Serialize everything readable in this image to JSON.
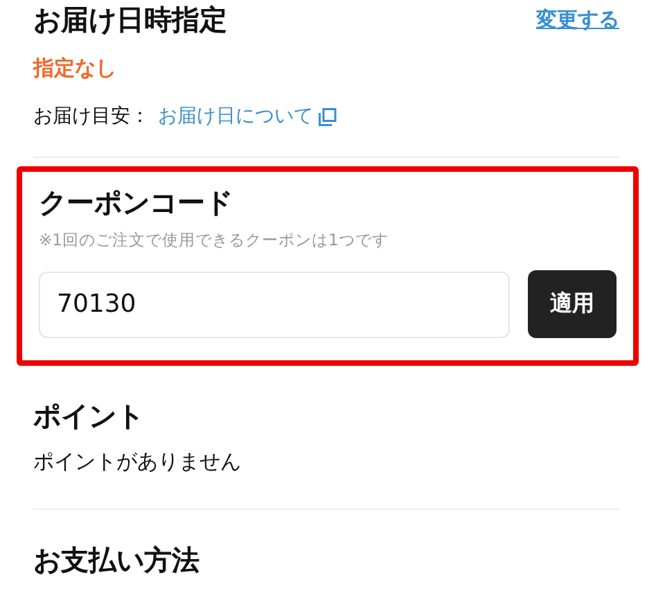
{
  "delivery": {
    "title": "お届け日時指定",
    "change_link": "変更する",
    "selection": "指定なし",
    "estimate_label": "お届け目安：",
    "estimate_link": "お届け日について"
  },
  "coupon": {
    "highlighted": true,
    "title": "クーポンコード",
    "note": "※1回のご注文で使用できるクーポンは1つです",
    "code": "70130",
    "apply_button": "適用"
  },
  "points": {
    "title": "ポイント",
    "message": "ポイントがありません"
  },
  "payment": {
    "title": "お支払い方法"
  }
}
